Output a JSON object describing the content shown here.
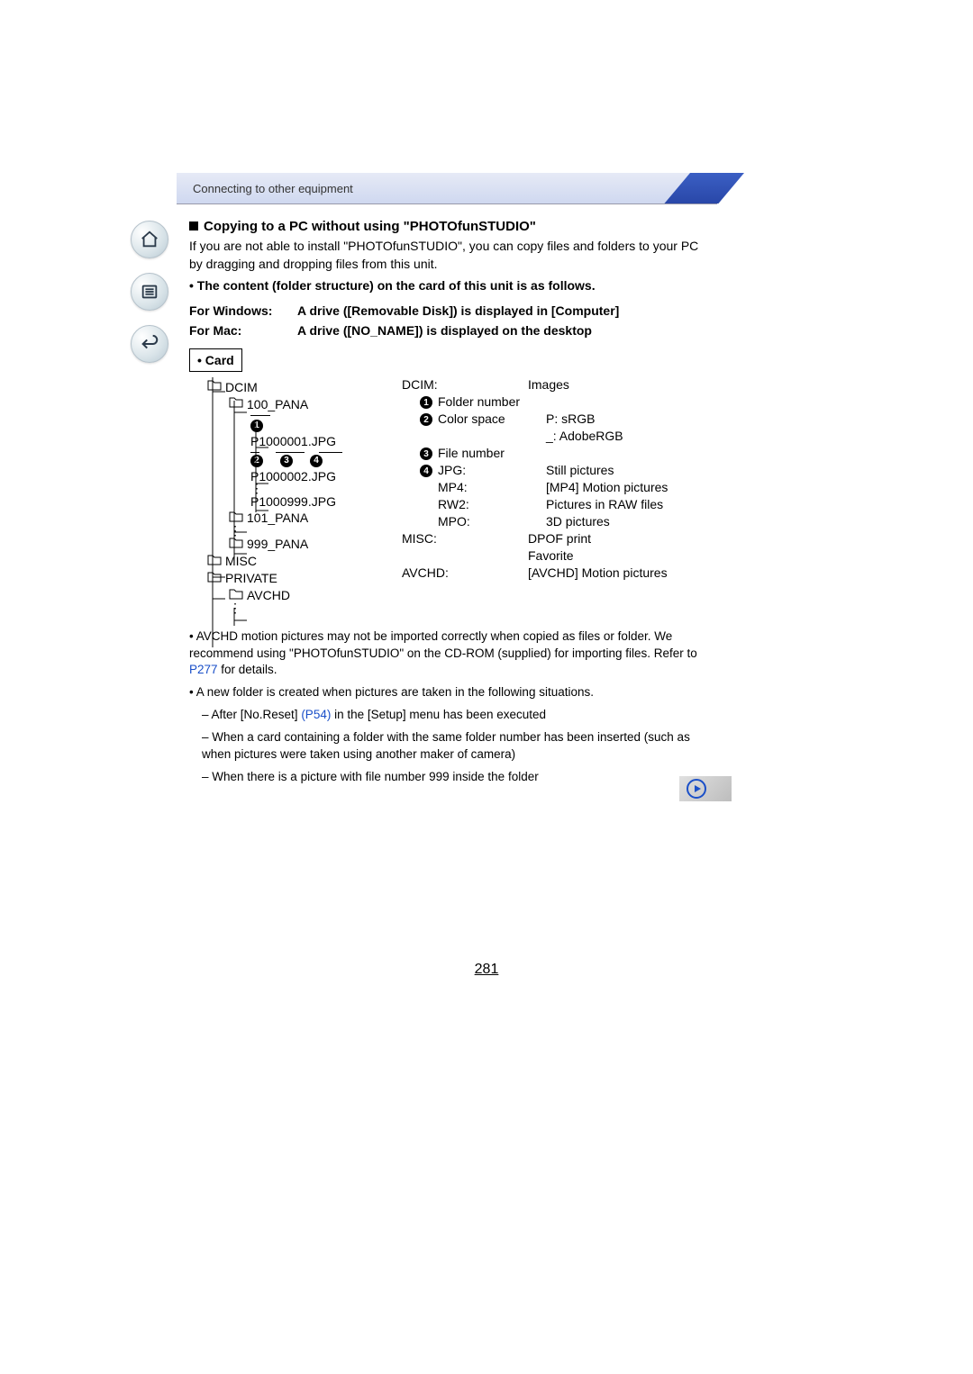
{
  "header": {
    "breadcrumb": "Connecting to other equipment"
  },
  "section": {
    "title": "Copying to a PC without using \"PHOTOfunSTUDIO\"",
    "intro": "If you are not able to install \"PHOTOfunSTUDIO\", you can copy files and folders to your PC by dragging and dropping files from this unit.",
    "bullet_bold": "The content (folder structure) on the card of this unit is as follows."
  },
  "os": {
    "win_label": "For Windows:",
    "win_desc": "A drive ([Removable Disk]) is displayed in [Computer]",
    "mac_label": "For Mac:",
    "mac_desc": "A drive ([NO_NAME]) is displayed on the desktop"
  },
  "card_label": "Card",
  "tree": {
    "dcim": "DCIM",
    "pana100": "100_PANA",
    "f1": "P1000001.JPG",
    "f2": "P1000002.JPG",
    "f999": "P1000999.JPG",
    "pana101": "101_PANA",
    "pana999": "999_PANA",
    "misc": "MISC",
    "private": "PRIVATE",
    "avchd": "AVCHD"
  },
  "defs": [
    {
      "label": "DCIM:",
      "val": "Images",
      "indent": 0
    },
    {
      "label": "Folder number",
      "val": "",
      "num": "1",
      "indent": 1
    },
    {
      "label": "Color space",
      "val": "P: sRGB",
      "num": "2",
      "indent": 1
    },
    {
      "label": "",
      "val": "_: AdobeRGB",
      "indent": 1
    },
    {
      "label": "File number",
      "val": "",
      "num": "3",
      "indent": 1
    },
    {
      "label": "JPG:",
      "val": "Still pictures",
      "num": "4",
      "indent": 1
    },
    {
      "label": "MP4:",
      "val": "[MP4] Motion pictures",
      "indent": 1,
      "pad": true
    },
    {
      "label": "RW2:",
      "val": "Pictures in RAW files",
      "indent": 1,
      "pad": true
    },
    {
      "label": "MPO:",
      "val": "3D pictures",
      "indent": 1,
      "pad": true
    },
    {
      "label": "MISC:",
      "val": "DPOF print",
      "indent": 0
    },
    {
      "label": "",
      "val": "Favorite",
      "indent": 0
    },
    {
      "label": "AVCHD:",
      "val": "[AVCHD] Motion pictures",
      "indent": 0
    }
  ],
  "notes": {
    "n1a": "AVCHD motion pictures may not be imported correctly when copied as files or folder. We recommend using \"PHOTOfunSTUDIO\" on the CD-ROM (supplied) for importing files. Refer to ",
    "n1link": "P277",
    "n1b": " for details.",
    "n2": "A new folder is created when pictures are taken in the following situations.",
    "n2a_pre": "After [No.Reset] ",
    "n2a_link": "(P54)",
    "n2a_post": " in the [Setup] menu has been executed",
    "n2b": "When a card containing a folder with the same folder number has been inserted (such as when pictures were taken using another maker of camera)",
    "n2c": "When there is a picture with file number 999 inside the folder"
  },
  "page_number": "281"
}
